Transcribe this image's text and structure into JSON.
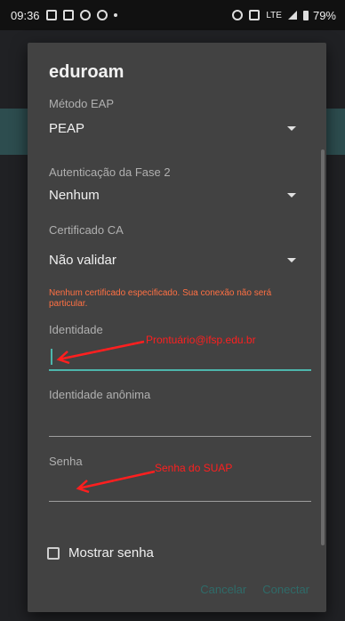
{
  "status_bar": {
    "time": "09:36",
    "network": "LTE",
    "battery": "79%"
  },
  "dialog": {
    "title": "eduroam",
    "eap_method": {
      "label": "Método EAP",
      "value": "PEAP"
    },
    "phase2_auth": {
      "label": "Autenticação da Fase 2",
      "value": "Nenhum"
    },
    "ca_certificate": {
      "label": "Certificado CA",
      "value": "Não validar"
    },
    "warning": "Nenhum certificado especificado. Sua conexão não será particular.",
    "identity": {
      "label": "Identidade",
      "value": ""
    },
    "anonymous_identity": {
      "label": "Identidade anônima",
      "value": ""
    },
    "password": {
      "label": "Senha",
      "value": ""
    },
    "show_password": "Mostrar senha",
    "buttons": {
      "cancel": "Cancelar",
      "connect": "Conectar"
    }
  },
  "annotations": {
    "identity_hint": "Prontuário@ifsp.edu.br",
    "password_hint": "Senha do SUAP"
  },
  "colors": {
    "accent": "#4db6ac",
    "warning": "#ff7043",
    "annotation": "#ff1f1f",
    "button_text": "#2f6b69"
  }
}
